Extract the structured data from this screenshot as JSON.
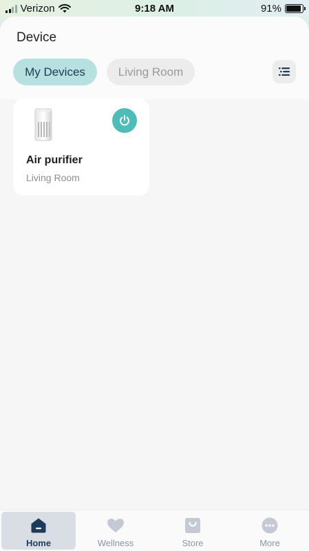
{
  "status_bar": {
    "carrier": "Verizon",
    "time": "9:18 AM",
    "battery_percent": "91%",
    "battery_level": 0.91
  },
  "header": {
    "title": "Device"
  },
  "filters": {
    "items": [
      {
        "label": "My Devices",
        "active": true
      },
      {
        "label": "Living Room",
        "active": false
      }
    ],
    "filter_icon": "filter-list-icon"
  },
  "devices": [
    {
      "name": "Air purifier",
      "room": "Living Room",
      "icon": "air-purifier-icon",
      "power_icon": "power-icon",
      "power_on": true
    }
  ],
  "tab_bar": {
    "items": [
      {
        "label": "Home",
        "icon": "home-icon",
        "active": true
      },
      {
        "label": "Wellness",
        "icon": "heart-icon",
        "active": false
      },
      {
        "label": "Store",
        "icon": "shopping-bag-icon",
        "active": false
      },
      {
        "label": "More",
        "icon": "more-icon",
        "active": false
      }
    ]
  },
  "colors": {
    "accent": "#4ebdb7",
    "chip_active_bg": "#b7e0e1",
    "nav_active": "#1f3b5c",
    "nav_inactive": "#8a95a5"
  }
}
